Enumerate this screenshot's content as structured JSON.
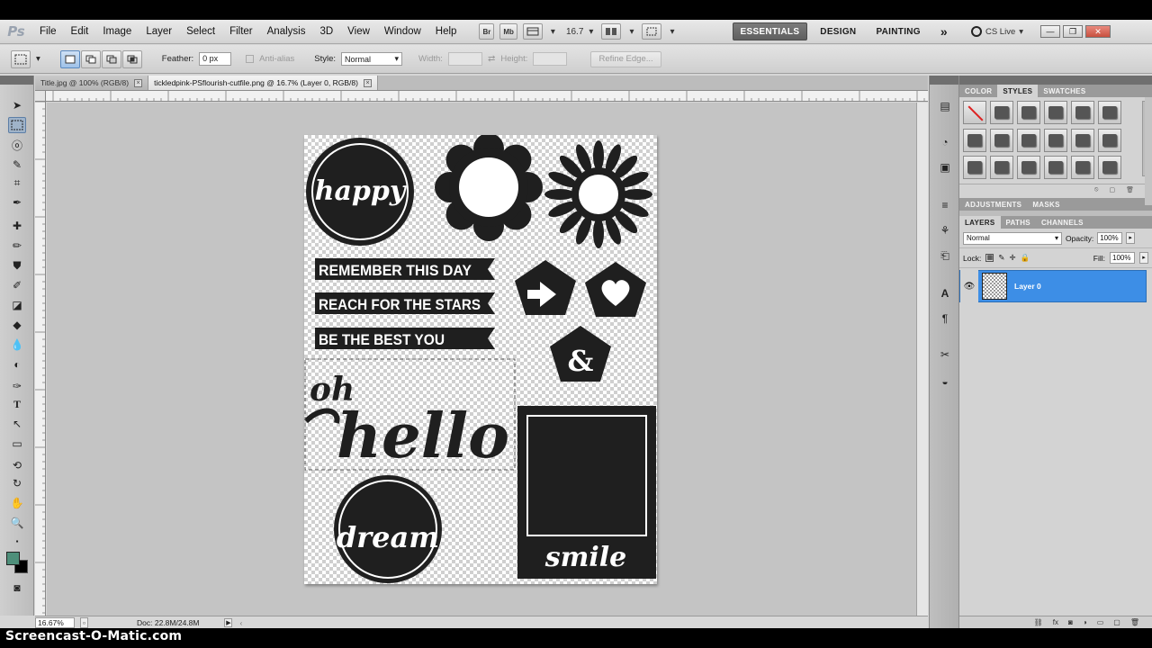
{
  "app": {
    "logo": "Ps"
  },
  "menu": {
    "items": [
      "File",
      "Edit",
      "Image",
      "Layer",
      "Select",
      "Filter",
      "Analysis",
      "3D",
      "View",
      "Window",
      "Help"
    ],
    "br_label": "Br",
    "mb_label": "Mb",
    "zoom_level": "16.7",
    "workspaces": [
      "ESSENTIALS",
      "DESIGN",
      "PAINTING"
    ],
    "more": "»",
    "cs_live": "CS Live"
  },
  "options": {
    "feather_label": "Feather:",
    "feather_value": "0 px",
    "antialias_label": "Anti-alias",
    "style_label": "Style:",
    "style_value": "Normal",
    "width_label": "Width:",
    "height_label": "Height:",
    "refine_edge": "Refine Edge..."
  },
  "doc_tabs": [
    {
      "title": "Title.jpg @ 100% (RGB/8)"
    },
    {
      "title": "tickledpink-PSflourish-cutfile.png @ 16.7% (Layer 0, RGB/8)"
    }
  ],
  "ruler": {
    "h_ticks": [
      "0",
      "2",
      "4",
      "6",
      "8",
      "10",
      "12",
      "14"
    ]
  },
  "status": {
    "zoom": "16.67%",
    "doc": "Doc: 22.8M/24.8M"
  },
  "panels": {
    "top_tabs": [
      "COLOR",
      "STYLES",
      "SWATCHES"
    ],
    "adj_tabs": [
      "ADJUSTMENTS",
      "MASKS"
    ],
    "layer_tabs": [
      "LAYERS",
      "PATHS",
      "CHANNELS"
    ],
    "blend_mode": "Normal",
    "opacity_label": "Opacity:",
    "opacity_value": "100%",
    "lock_label": "Lock:",
    "fill_label": "Fill:",
    "fill_value": "100%",
    "layer_name": "Layer 0"
  },
  "artwork": {
    "happy": "happy",
    "banners": [
      "REMEMBER THIS DAY",
      "REACH FOR THE STARS",
      "BE THE BEST YOU"
    ],
    "ampersand": "&",
    "oh": "oh",
    "hello": "hello",
    "dream": "dream",
    "smile": "smile"
  },
  "watermark": "Screencast-O-Matic.com"
}
